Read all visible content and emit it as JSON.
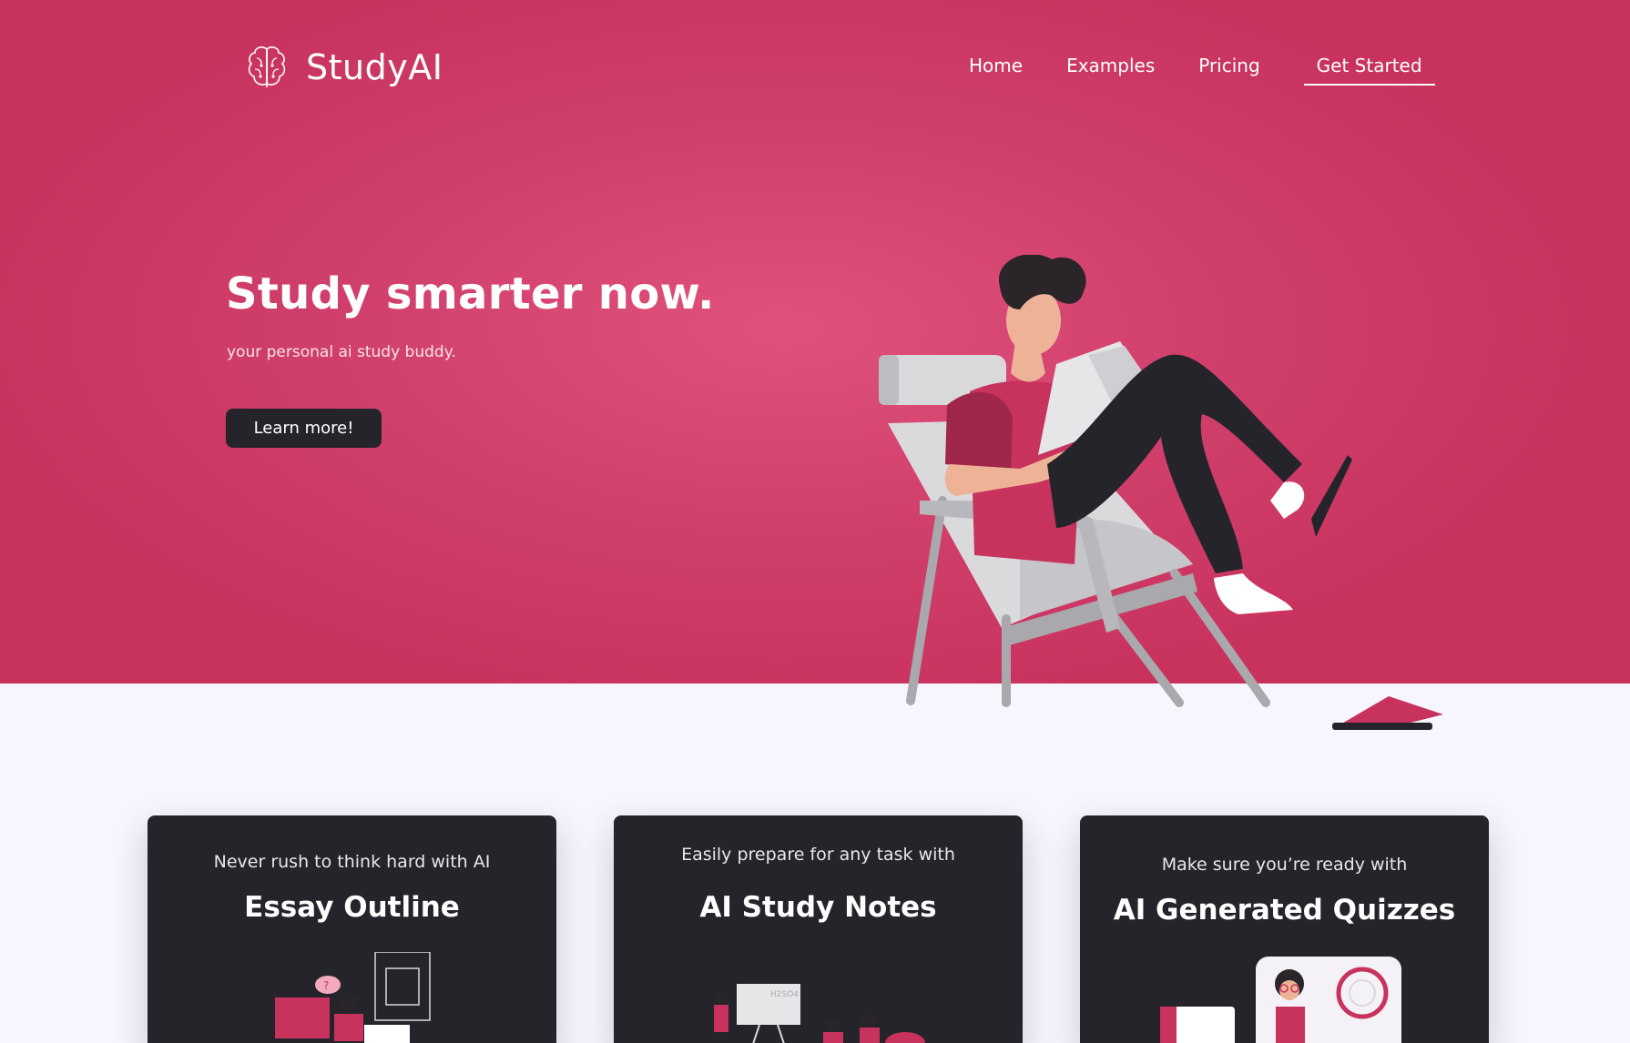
{
  "brand": {
    "name": "StudyAI",
    "logo_icon": "brain-icon"
  },
  "nav": {
    "items": [
      "Home",
      "Examples",
      "Pricing"
    ],
    "cta": "Get Started"
  },
  "hero": {
    "title": "Study smarter now.",
    "subtitle": "your personal ai study buddy.",
    "button": "Learn more!",
    "illustration": "person-reading-in-chair"
  },
  "colors": {
    "primary": "#d03f6b",
    "dark": "#26242b",
    "background": "#f7f5fd",
    "chair": "#c9c9cc"
  },
  "cards": [
    {
      "subtitle": "Never rush to think hard with AI",
      "title": "Essay Outline",
      "illustration": "stressed-student-at-desk"
    },
    {
      "subtitle": "Easily prepare for any task with",
      "title": "AI Study Notes",
      "illustration": "classroom-presentation"
    },
    {
      "subtitle": "Make sure you’re ready with",
      "title": "AI Generated Quizzes",
      "illustration": "quiz-results-screen"
    }
  ],
  "illustration_text": {
    "whiteboard": "H2SO4"
  }
}
